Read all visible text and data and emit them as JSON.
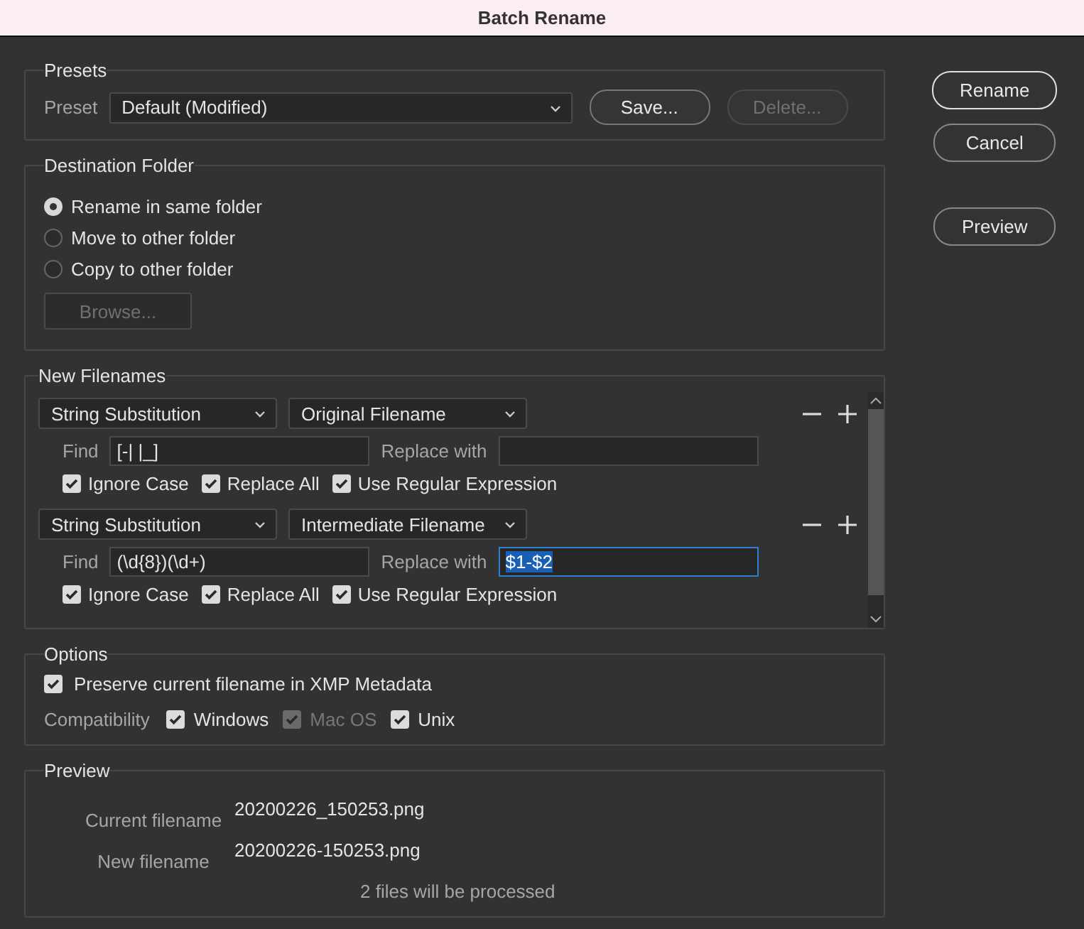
{
  "window": {
    "title": "Batch Rename"
  },
  "presets": {
    "title": "Presets",
    "label": "Preset",
    "value": "Default (Modified)",
    "buttons": [
      {
        "label": "Save...",
        "disabled": false
      },
      {
        "label": "Delete...",
        "disabled": true
      }
    ]
  },
  "destination": {
    "title": "Destination Folder",
    "options": [
      {
        "label": "Rename in same folder",
        "selected": true
      },
      {
        "label": "Move to other folder",
        "selected": false
      },
      {
        "label": "Copy to other folder",
        "selected": false
      }
    ],
    "browse": {
      "label": "Browse...",
      "disabled": true
    }
  },
  "new_filenames": {
    "title": "New Filenames",
    "rules": [
      {
        "type": "String Substitution",
        "source": "Original Filename",
        "find_label": "Find",
        "find": "[-| |_]",
        "replace_label": "Replace with",
        "replace_selected": false,
        "checks": [
          {
            "label": "Ignore Case",
            "checked": true
          },
          {
            "label": "Replace All",
            "checked": true
          },
          {
            "label": "Use Regular Expression",
            "checked": true
          }
        ]
      },
      {
        "type": "String Substitution",
        "source": "Intermediate Filename",
        "find_label": "Find",
        "find": "(\\d{8})(\\d+)",
        "replace_label": "Replace with",
        "replace": "$1-$2",
        "replace_selected": true,
        "checks": [
          {
            "label": "Ignore Case",
            "checked": true
          },
          {
            "label": "Replace All",
            "checked": true
          },
          {
            "label": "Use Regular Expression",
            "checked": true
          }
        ]
      }
    ]
  },
  "options": {
    "title": "Options",
    "preserve": {
      "label": "Preserve current filename in XMP Metadata",
      "checked": true
    },
    "compatibility_label": "Compatibility",
    "compatibility": [
      {
        "label": "Windows",
        "checked": true,
        "disabled": false
      },
      {
        "label": "Mac OS",
        "checked": true,
        "disabled": true
      },
      {
        "label": "Unix",
        "checked": true,
        "disabled": false
      }
    ]
  },
  "preview": {
    "title": "Preview",
    "rows": [
      {
        "label": "Current filename",
        "value": "20200226_150253.png"
      },
      {
        "label": "New filename",
        "value": "20200226-150253.png"
      }
    ],
    "summary": "2 files will be processed"
  },
  "actions": [
    {
      "label": "Rename",
      "default": true
    },
    {
      "label": "Cancel",
      "default": false
    }
  ],
  "secondary_actions": [
    {
      "label": "Preview",
      "default": false
    }
  ]
}
